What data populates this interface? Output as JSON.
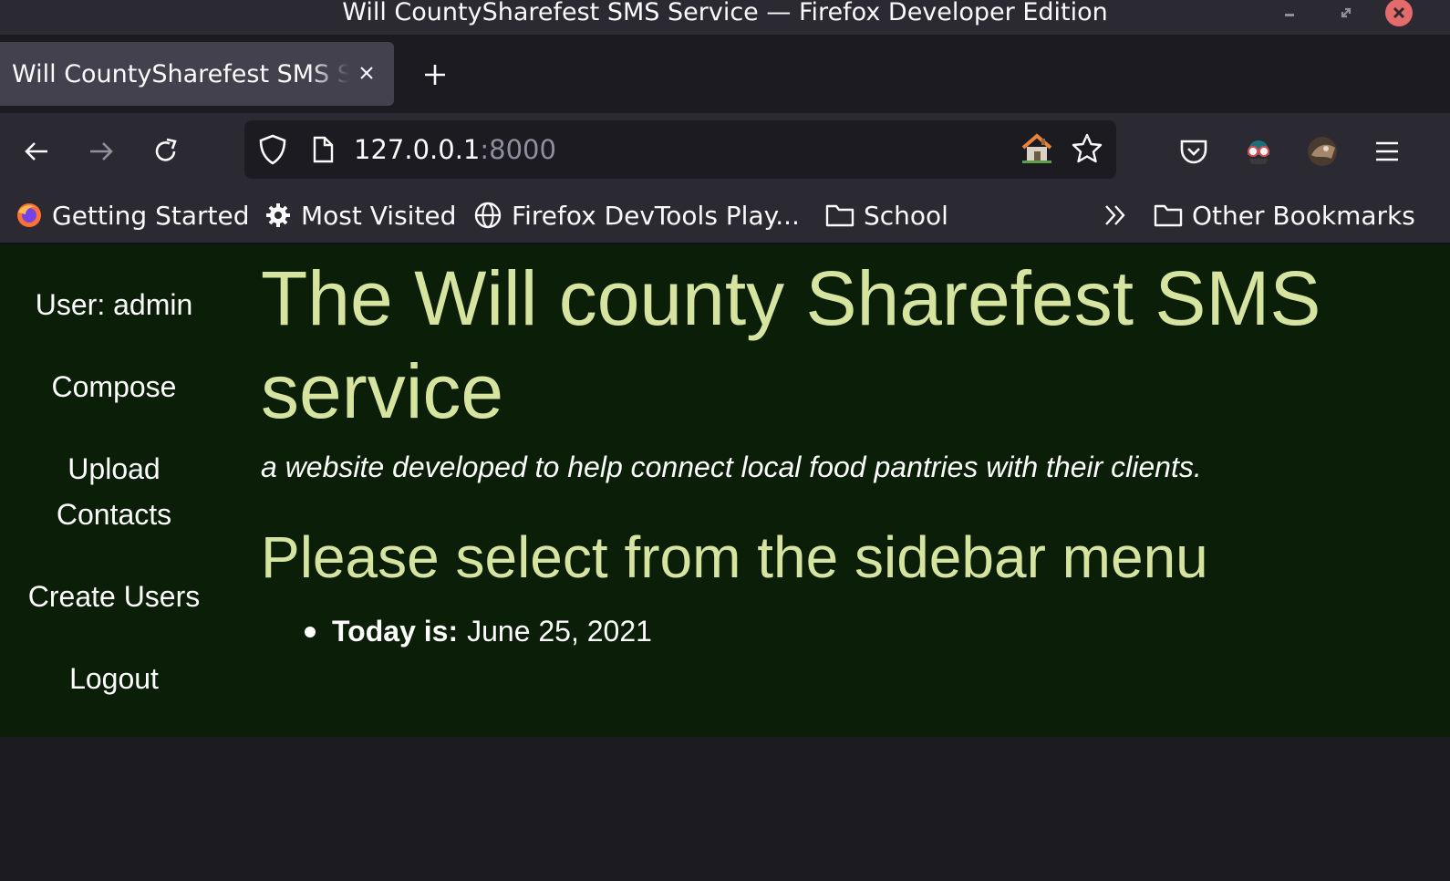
{
  "window": {
    "title": "Will CountySharefest SMS Service — Firefox Developer Edition"
  },
  "tabs": [
    {
      "title": "Will CountySharefest SMS Service",
      "active": true
    }
  ],
  "toolbar": {
    "url_host": "127.0.0.1",
    "url_port": ":8000"
  },
  "bookmarks": {
    "items": [
      {
        "label": "Getting Started",
        "icon": "firefox-logo-icon"
      },
      {
        "label": "Most Visited",
        "icon": "gear-icon"
      },
      {
        "label": "Firefox DevTools Play...",
        "icon": "globe-icon"
      },
      {
        "label": "School",
        "icon": "folder-icon"
      }
    ],
    "overflow_icon": "double-chevron-right-icon",
    "other": {
      "label": "Other Bookmarks",
      "icon": "folder-icon"
    }
  },
  "sidebar": {
    "user_label": "User: admin",
    "items": [
      {
        "label": "Compose"
      },
      {
        "label": "Upload Contacts"
      },
      {
        "label": "Create Users"
      },
      {
        "label": "Logout"
      }
    ]
  },
  "main": {
    "title": "The Will county Sharefest SMS service",
    "tagline": "a website developed to help connect local food pantries with their clients.",
    "prompt": "Please select from the sidebar menu",
    "date_label": "Today is:",
    "date_value": "June 25, 2021"
  },
  "colors": {
    "page_background": "#0a1e08",
    "heading_color": "#d6e4a0",
    "browser_chrome": "#2b2a33"
  }
}
